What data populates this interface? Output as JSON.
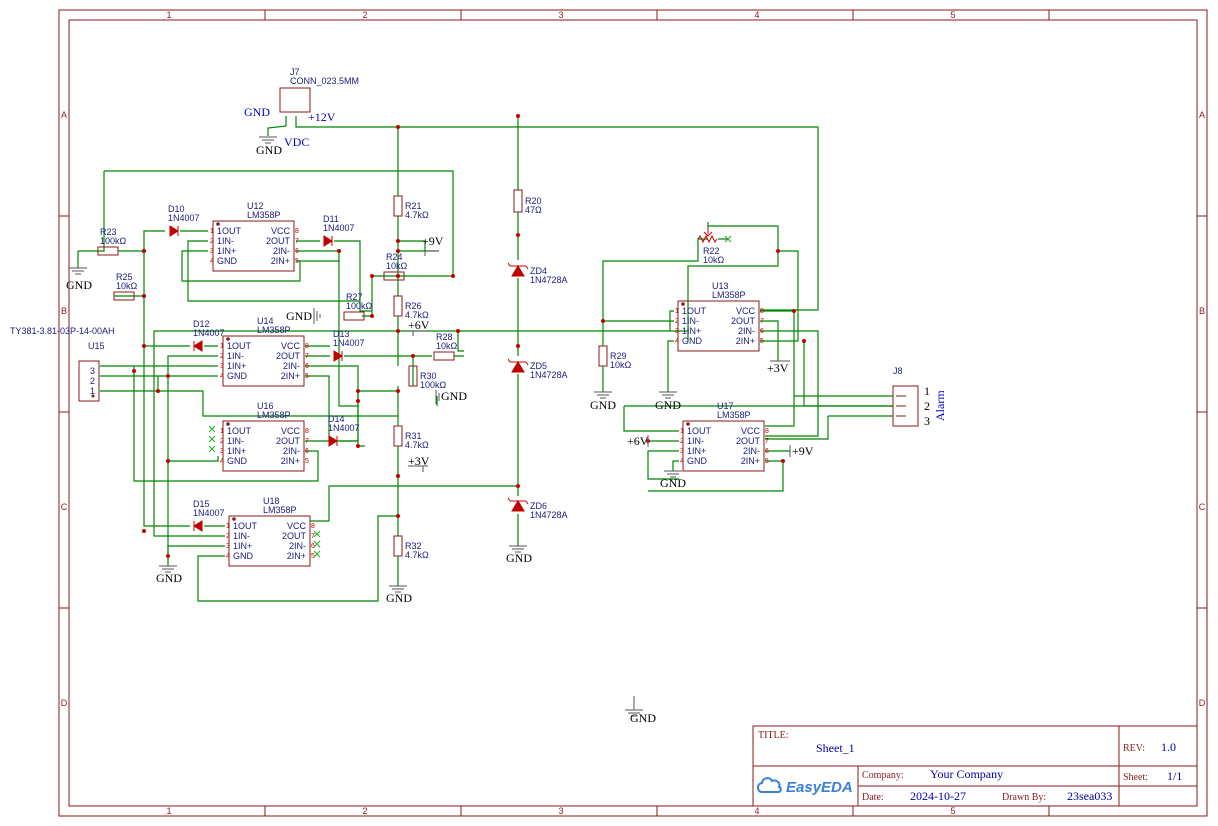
{
  "frame": {
    "columns": [
      "1",
      "2",
      "3",
      "4",
      "5"
    ],
    "rows": [
      "A",
      "B",
      "C",
      "D"
    ]
  },
  "connectors": {
    "j7": {
      "ref": "J7",
      "value": "CONN_023.5MM",
      "net_gnd": "GND",
      "net_12v": "+12V",
      "gnd": "GND",
      "vdc": "VDC"
    },
    "u15": {
      "ref": "U15",
      "value": "TY381-3.81-03P-14-00AH",
      "pins": [
        "3",
        "2",
        "1"
      ]
    },
    "j8": {
      "ref": "J8",
      "label": "Alarm",
      "pins": [
        "1",
        "2",
        "3"
      ]
    }
  },
  "resistors": [
    {
      "ref": "R23",
      "value": "100kΩ"
    },
    {
      "ref": "R25",
      "value": "10kΩ"
    },
    {
      "ref": "R21",
      "value": "4.7kΩ"
    },
    {
      "ref": "R24",
      "value": "10kΩ"
    },
    {
      "ref": "R26",
      "value": "4.7kΩ"
    },
    {
      "ref": "R27",
      "value": "100kΩ"
    },
    {
      "ref": "R28",
      "value": "10kΩ"
    },
    {
      "ref": "R30",
      "value": "100kΩ"
    },
    {
      "ref": "R31",
      "value": "4.7kΩ"
    },
    {
      "ref": "R32",
      "value": "4.7kΩ"
    },
    {
      "ref": "R20",
      "value": "47Ω"
    },
    {
      "ref": "R22",
      "value": "10kΩ"
    },
    {
      "ref": "R29",
      "value": "10kΩ"
    }
  ],
  "diodes": [
    {
      "ref": "D10",
      "value": "1N4007"
    },
    {
      "ref": "D11",
      "value": "1N4007"
    },
    {
      "ref": "D12",
      "value": "1N4007"
    },
    {
      "ref": "D13",
      "value": "1N4007"
    },
    {
      "ref": "D14",
      "value": "1N4007"
    },
    {
      "ref": "D15",
      "value": "1N4007"
    }
  ],
  "zeners": [
    {
      "ref": "ZD4",
      "value": "1N4728A"
    },
    {
      "ref": "ZD5",
      "value": "1N4728A"
    },
    {
      "ref": "ZD6",
      "value": "1N4728A"
    }
  ],
  "opamps": [
    {
      "ref": "U12",
      "value": "LM358P"
    },
    {
      "ref": "U14",
      "value": "LM358P"
    },
    {
      "ref": "U16",
      "value": "LM358P"
    },
    {
      "ref": "U18",
      "value": "LM358P"
    },
    {
      "ref": "U13",
      "value": "LM358P"
    },
    {
      "ref": "U17",
      "value": "LM358P"
    }
  ],
  "opamp_pins": {
    "left": [
      "1OUT",
      "1IN-",
      "1IN+",
      "GND"
    ],
    "right": [
      "VCC",
      "2OUT",
      "2IN-",
      "2IN+"
    ],
    "left_nums": [
      "1",
      "2",
      "3",
      "4"
    ],
    "right_nums": [
      "8",
      "7",
      "6",
      "5"
    ]
  },
  "nets": {
    "plus9v": "+9V",
    "plus6v": "+6V",
    "plus3v": "+3V",
    "gnd": "GND"
  },
  "title_block": {
    "title_label": "TITLE:",
    "title": "Sheet_1",
    "rev_label": "REV:",
    "rev": "1.0",
    "company_label": "Company:",
    "company": "Your Company",
    "sheet_label": "Sheet:",
    "sheet": "1/1",
    "date_label": "Date:",
    "date": "2024-10-27",
    "drawn_label": "Drawn By:",
    "drawn_by": "23sea033",
    "logo": "EasyEDA"
  },
  "colors": {
    "frame": "#8b1a1a",
    "wire": "#008800",
    "component": "#8b1a1a",
    "net_label": "#0000cc",
    "ref_text": "#1a1a80",
    "pin_number": "#c00000"
  }
}
